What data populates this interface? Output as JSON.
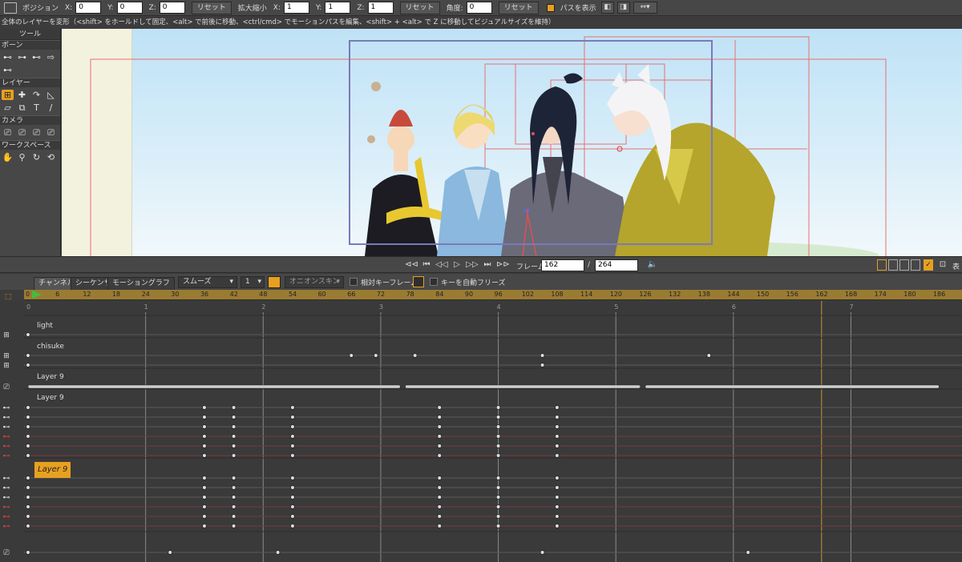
{
  "options_bar": {
    "position_label": "ポジション",
    "x_label": "X:",
    "x_value": "0",
    "y_label": "Y:",
    "y_value": "0",
    "z_label": "Z:",
    "z_value": "0",
    "reset1": "リセット",
    "scale_label": "拡大縮小",
    "sx_label": "X:",
    "sx_value": "1",
    "sy_label": "Y:",
    "sy_value": "1",
    "sz_label": "Z:",
    "sz_value": "1",
    "reset2": "リセット",
    "angle_label": "角度:",
    "angle_value": "0",
    "reset3": "リセット",
    "show_path_label": "パスを表示"
  },
  "hint": "全体のレイヤーを変形（<shift> をホールドして固定、<alt> で前後に移動、<ctrl/cmd> でモーションパスを編集、<shift> + <alt> で Z に移動してビジュアルサイズを維持）",
  "tools": {
    "title": "ツール",
    "sections": [
      "ボーン",
      "レイヤー",
      "カメラ",
      "ワークスペース"
    ]
  },
  "playbar": {
    "frame_label": "フレーム",
    "frame_value": "162",
    "separator": "/",
    "total_frames": "264",
    "right_label": "表"
  },
  "timeline_opts": {
    "tabs": [
      "チャンネル",
      "シーケンサ",
      "モーショングラフ"
    ],
    "interp": "スムーズ",
    "interp_count": "1",
    "onion": "オニオンスキン",
    "relative_keys": "相対キーフレーム",
    "freeze_keys": "キーを自動フリーズ"
  },
  "ruler": {
    "ticks": [
      "0",
      "6",
      "12",
      "18",
      "24",
      "30",
      "36",
      "42",
      "48",
      "54",
      "60",
      "66",
      "72",
      "78",
      "84",
      "90",
      "96",
      "102",
      "108",
      "114",
      "120",
      "126",
      "132",
      "138",
      "144",
      "150",
      "156",
      "162",
      "168",
      "174",
      "180",
      "186"
    ],
    "current_frame": 162
  },
  "seconds": [
    "0",
    "1",
    "2",
    "3",
    "4",
    "5",
    "6",
    "7"
  ],
  "layers": {
    "light": "light",
    "chisuke": "chisuke",
    "layer9a": "Layer 9",
    "layer9b": "Layer 9",
    "layer9_badge": "Layer 9"
  },
  "colors": {
    "accent": "#e8a020",
    "ruler": "#9a7b32",
    "playhead": "#c8962a",
    "selection": "#7a7ab8"
  }
}
